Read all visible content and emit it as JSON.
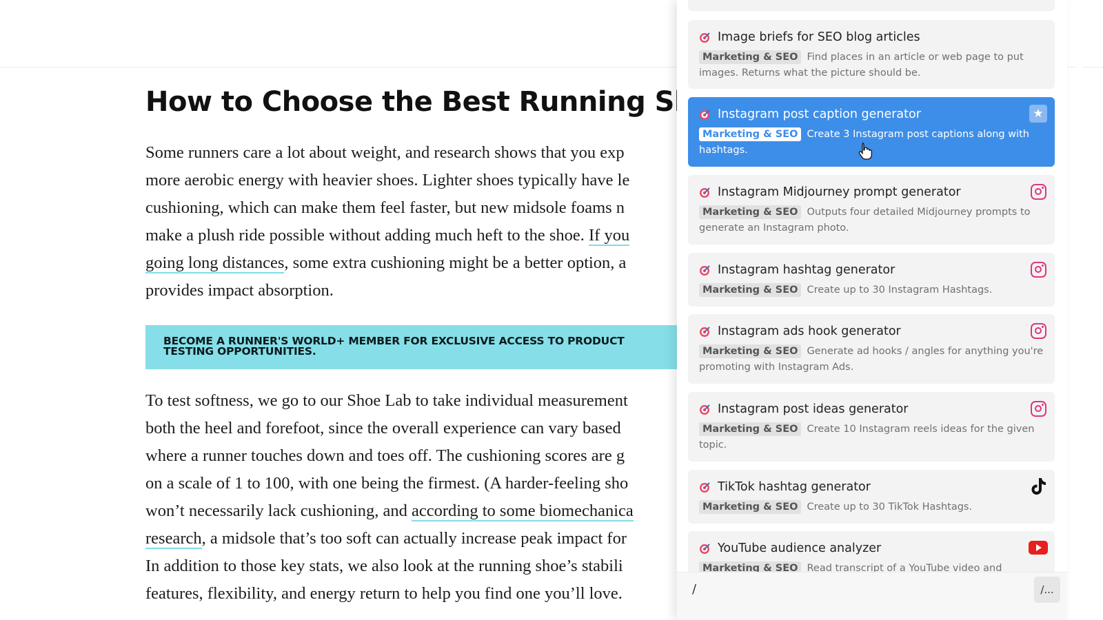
{
  "article": {
    "title": "How to Choose the Best Running Shoe",
    "para1": {
      "l1": "Some runners care a lot about weight, and research shows that you exp",
      "l2": "more aerobic energy with heavier shoes. Lighter shoes typically have le",
      "l3": "cushioning, which can make them feel faster, but new midsole foams n",
      "l4a": "make a plush ride possible without adding much heft to the shoe. ",
      "l4link": "If you",
      "l5link": "going long distances",
      "l5b": ", some extra cushioning might be a better option, a",
      "l6": "provides impact absorption."
    },
    "banner": "BECOME A RUNNER'S WORLD+ MEMBER FOR EXCLUSIVE ACCESS TO PRODUCT TESTING OPPORTUNITIES.",
    "para2": {
      "l1": "To test softness, we go to our Shoe Lab to take individual measurement",
      "l2": "both the heel and forefoot, since the overall experience can vary based",
      "l3": "where a runner touches down and toes off. The cushioning scores are g",
      "l4": "on a scale of 1 to 100, with one being the firmest. (A harder-feeling sho",
      "l5a": "won’t necessarily lack cushioning, and ",
      "l5link": "according to some biomechanica",
      "l6link": "research",
      "l6b": ", a midsole that’s too soft can actually increase peak impact for",
      "l7": "In addition to those key stats, we also look at the running shoe’s stabili",
      "l8": "features, flexibility, and energy return to help you find one you’ll love."
    }
  },
  "panel": {
    "prompts": [
      {
        "title": "Image briefs for SEO blog articles",
        "tag": "Marketing & SEO",
        "desc": "Find places in an article or web page to put images. Returns what the picture should be.",
        "icon": "none"
      },
      {
        "title": "Instagram post caption generator",
        "tag": "Marketing & SEO",
        "desc": "Create 3 Instagram post captions along with hashtags.",
        "icon": "star-icon"
      },
      {
        "title": "Instagram Midjourney prompt generator",
        "tag": "Marketing & SEO",
        "desc": "Outputs four detailed Midjourney prompts to generate an Instagram photo.",
        "icon": "instagram-icon"
      },
      {
        "title": "Instagram hashtag generator",
        "tag": "Marketing & SEO",
        "desc": "Create up to 30 Instagram Hashtags.",
        "icon": "instagram-icon"
      },
      {
        "title": "Instagram ads hook generator",
        "tag": "Marketing & SEO",
        "desc": "Generate ad hooks / angles for anything you're promoting with Instagram Ads.",
        "icon": "instagram-icon"
      },
      {
        "title": "Instagram post ideas generator",
        "tag": "Marketing & SEO",
        "desc": "Create 10 Instagram reels ideas for the given topic.",
        "icon": "instagram-icon"
      },
      {
        "title": "TikTok hashtag generator",
        "tag": "Marketing & SEO",
        "desc": "Create up to 30 TikTok Hashtags.",
        "icon": "tiktok-icon"
      },
      {
        "title": "YouTube audience analyzer",
        "tag": "Marketing & SEO",
        "desc": "Read transcript of a YouTube video and",
        "icon": "youtube-icon"
      }
    ],
    "input_value": "/",
    "command_button": "/..."
  },
  "colors": {
    "accent": "#3d8ee8",
    "banner": "#86dfe8",
    "link_underline": "#7fdde6",
    "instagram": "#e0357d",
    "youtube": "#e81f1f"
  }
}
